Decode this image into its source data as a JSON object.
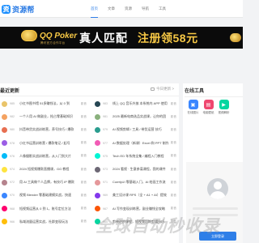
{
  "site": {
    "logo_text": "资源帮",
    "logo_mark": "资"
  },
  "nav": [
    {
      "label": "首页",
      "active": true
    },
    {
      "label": "文章",
      "active": false
    },
    {
      "label": "资源",
      "active": false
    },
    {
      "label": "导航",
      "active": false
    },
    {
      "label": "工具",
      "active": false
    }
  ],
  "banner": {
    "brand": "QQ Poker",
    "brand_sub": "腾讯官方合作平台",
    "title": "真人匹配",
    "promo": "注册领58元"
  },
  "main": {
    "title": "最近更新",
    "more": "今日更新 >",
    "rows": [
      {
        "left": {
          "tag": "985",
          "title": "小红书图书馆 51多赚钱法，从 0 到",
          "date": "影音",
          "thumb": "#e9c46a"
        },
        "right": {
          "tag": "983",
          "title": "线上 QQ 音乐外放 本系统内 APP 使用",
          "date": "影音",
          "thumb": "#264653"
        }
      },
      {
        "left": {
          "tag": "982",
          "title": "一个人用 AI 做副业，抢占零基础知识",
          "date": "影音",
          "thumb": "#f4a261"
        },
        "right": {
          "tag": "981",
          "title": "2025 最新电商选品实战课，让你的团",
          "date": "影音",
          "thumb": "#8ab17d"
        }
      },
      {
        "left": {
          "tag": "980",
          "title": "抖音带货实战训练营，养号技巧 / 爆款",
          "date": "影音",
          "thumb": "#e76f51"
        },
        "right": {
          "tag": "979",
          "title": "AI 视频剪辑 / 工具 / 带货运营 技巧",
          "date": "影音",
          "thumb": "#2a9d8f"
        }
      },
      {
        "left": {
          "tag": "978",
          "title": "小红书运营训练营 / 爆款笔记 / 起号",
          "date": "影音",
          "thumb": "#9b5de5"
        },
        "right": {
          "tag": "977",
          "title": "AI 数据处理（新课）Excel 和 PPT 制作",
          "date": "影音",
          "thumb": "#f15bb5"
        }
      },
      {
        "left": {
          "tag": "976",
          "title": "人像摄影实战训练营，从入门到大片",
          "date": "影音",
          "thumb": "#00bbf9"
        },
        "right": {
          "tag": "975",
          "title": "Tech ED 年系统全集 / 编程入门教程",
          "date": "影音",
          "thumb": "#00f5d4"
        }
      },
      {
        "left": {
          "tag": "974",
          "title": "2024 短视频爆款直播课，GG 教程",
          "date": "影音",
          "thumb": "#fee440"
        },
        "right": {
          "tag": "973",
          "title": "2024 看视 · 生意参谋课程，我的课件",
          "date": "影音",
          "thumb": "#6d6875"
        }
      },
      {
        "left": {
          "tag": "972",
          "title": "用 AI 工具做个人品牌，有技巧 IP 爆款",
          "date": "影音",
          "thumb": "#b5838d"
        },
        "right": {
          "tag": "971",
          "title": "ComfyUI 零基础入门，AI 绘画工作流",
          "date": "影音",
          "thumb": "#e5989b"
        }
      },
      {
        "left": {
          "tag": "970",
          "title": "视频 Blender 零基础建模实战，快速",
          "date": "影音",
          "thumb": "#3a86ff"
        },
        "right": {
          "tag": "969",
          "title": "美工设计课 RPS（全 + A1 + AI）提效",
          "date": "影音",
          "thumb": "#8338ec"
        }
      },
      {
        "left": {
          "tag": "968",
          "title": "短视频运营从 0 到 1，账号定位方法",
          "date": "影音",
          "thumb": "#ff006e"
        },
        "right": {
          "tag": "967",
          "title": "AI 写作变现训练营，副业赚钱全攻略",
          "date": "影音",
          "thumb": "#fb5607"
        }
      },
      {
        "left": {
          "tag": "966",
          "title": "私域流量运营实战，社群变现玩法",
          "date": "影音",
          "thumb": "#ffbe0b"
        },
        "right": {
          "tag": "965",
          "title": "剪映进阶课程，短视频后期剪辑技巧",
          "date": "影音",
          "thumb": "#06d6a0"
        }
      }
    ]
  },
  "sidebar": {
    "title": "在线工具",
    "tools": [
      {
        "label": "在线图片",
        "icon": "image-icon",
        "color": "#3a86ff",
        "glyph": "▣"
      },
      {
        "label": "电脑壁纸",
        "icon": "wallpaper-icon",
        "color": "#ef476f",
        "glyph": "▤"
      },
      {
        "label": "视频解析",
        "icon": "video-icon",
        "color": "#06d6a0",
        "glyph": "▶"
      }
    ],
    "login_label": "立即登录"
  },
  "watermark": "全球自动秒收录"
}
